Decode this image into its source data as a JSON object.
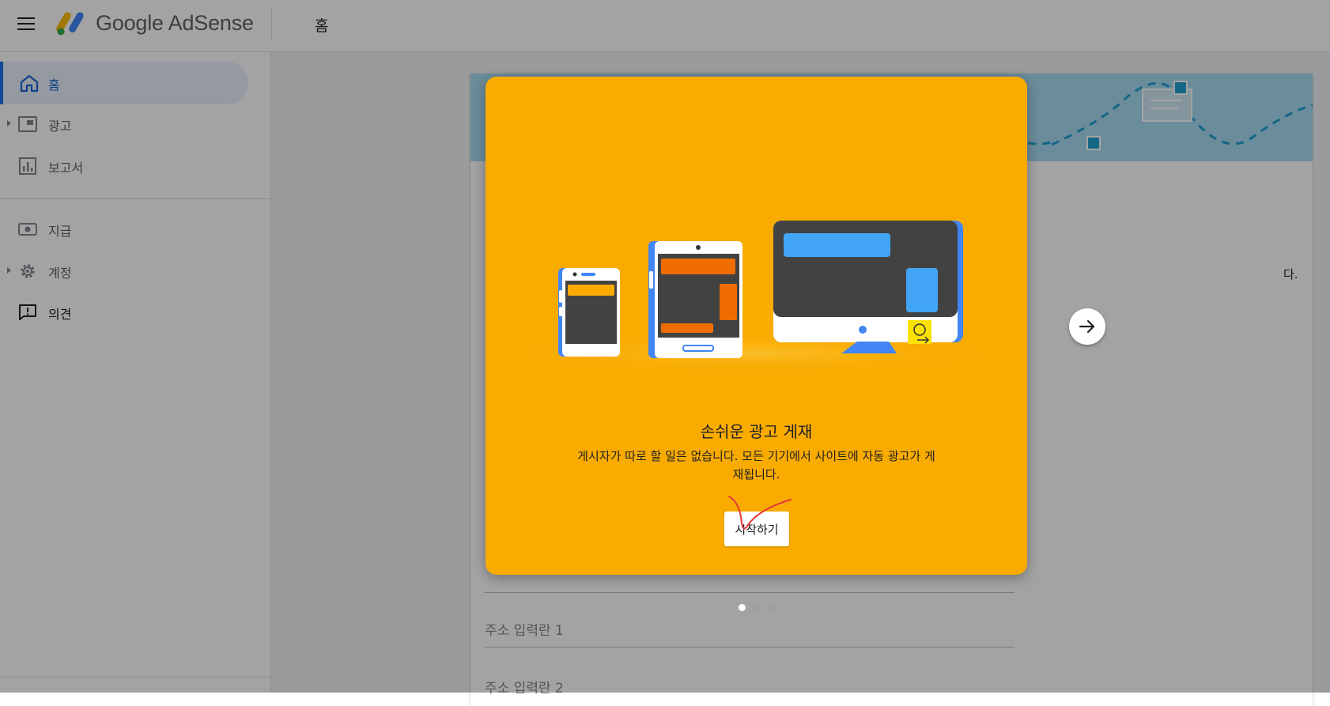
{
  "header": {
    "menu_icon": "hamburger-menu-icon",
    "logo_icon": "google-adsense-logo",
    "app_name": "Google AdSense",
    "page_title": "홈"
  },
  "sidebar": {
    "items": [
      {
        "label": "홈",
        "icon": "home-icon",
        "active": true
      },
      {
        "label": "광고",
        "icon": "ads-icon",
        "expandable": true
      },
      {
        "label": "보고서",
        "icon": "bar-chart-icon"
      },
      {
        "label": "지급",
        "icon": "payments-icon"
      },
      {
        "label": "계정",
        "icon": "gear-icon",
        "expandable": true
      },
      {
        "label": "의견",
        "icon": "feedback-icon"
      }
    ]
  },
  "main": {
    "truncated_text": "다.",
    "fields": [
      {
        "label": "주소 입력란 1"
      },
      {
        "label": "주소 입력란 2"
      }
    ]
  },
  "modal": {
    "title": "손쉬운 광고 게재",
    "description": "게시자가 따로 할 일은 없습니다. 모든 기기에서 사이트에 자동 광고가 게재됩니다.",
    "start_button": "시작하기",
    "next_icon": "arrow-right-icon",
    "page_count": 3,
    "current_page": 1
  },
  "colors": {
    "modal_bg": "#f9ab00",
    "accent_blue": "#1a73e8",
    "banner": "#a8dcf2",
    "annotation_red": "#e53935"
  }
}
